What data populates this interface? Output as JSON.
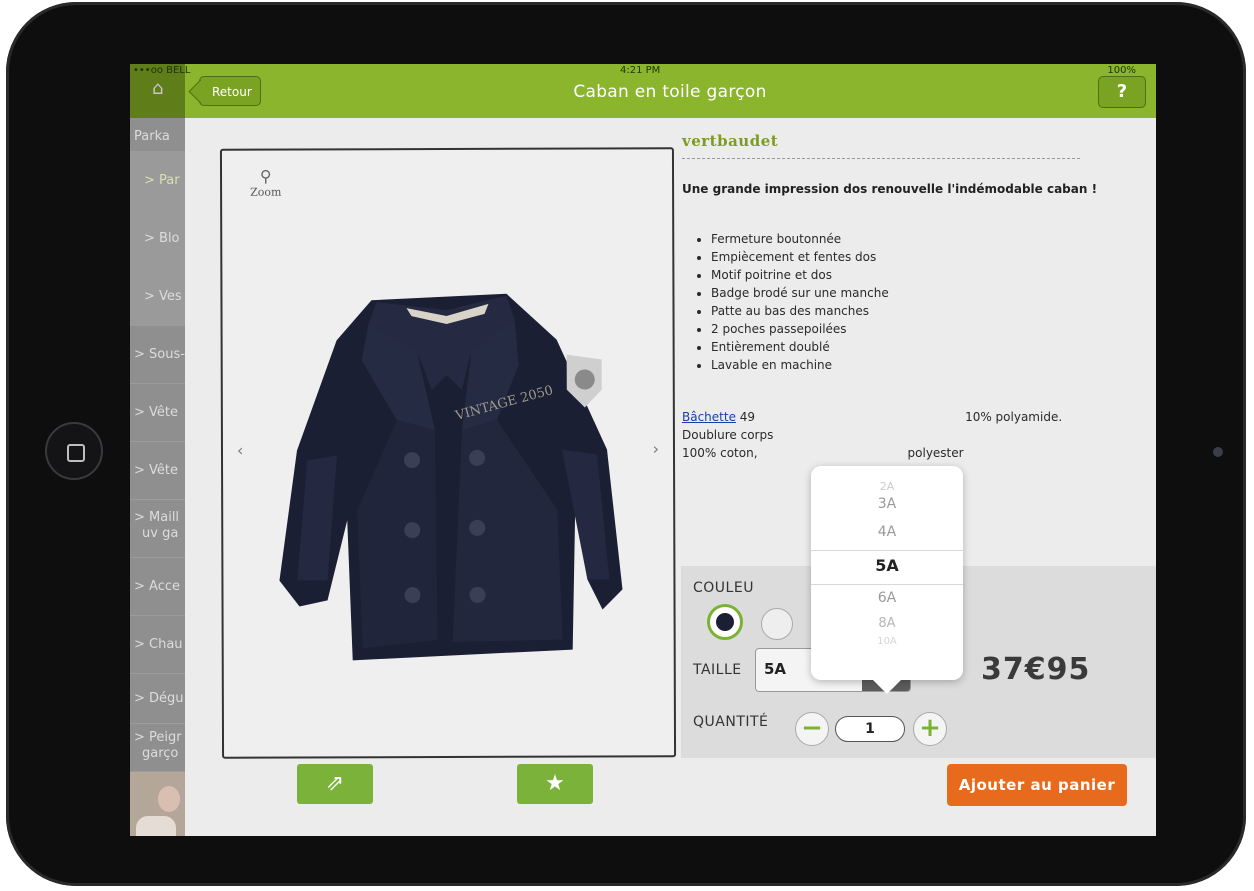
{
  "status": {
    "carrier": "•••oo BELL",
    "time": "4:21 PM",
    "battery": "100%"
  },
  "header": {
    "back_label": "Retour",
    "title": "Caban en toile garçon",
    "help_label": "?"
  },
  "sidebar": {
    "items": [
      {
        "label": "Parka"
      },
      {
        "label": "> Par"
      },
      {
        "label": "> Blo"
      },
      {
        "label": "> Ves"
      },
      {
        "label": "> Sous-"
      },
      {
        "label": "> Vête"
      },
      {
        "label": "> Vête"
      },
      {
        "label": "> Maill"
      },
      {
        "label": "uv ga"
      },
      {
        "label": "> Acce"
      },
      {
        "label": "> Chau"
      },
      {
        "label": "> Dégu"
      },
      {
        "label": "> Peigr"
      },
      {
        "label": "garço"
      }
    ]
  },
  "product": {
    "zoom_label": "Zoom",
    "brand": "vertbaudet",
    "tagline": "Une grande impression dos renouvelle l'indémodable caban !",
    "features": [
      "Fermeture boutonnée",
      "Empiècement et fentes dos",
      "Motif poitrine et dos",
      "Badge brodé sur une manche",
      "Patte au bas des manches",
      "2 poches passepoilées",
      "Entièrement doublé",
      "Lavable en machine"
    ],
    "material_link": "Bâchette",
    "material_text_1": " 49",
    "material_text_2": "10% polyamide. Doublure corps",
    "material_text_3": "100% coton,",
    "material_text_4": "polyester",
    "badge_text": "VINTAGE 2050"
  },
  "options": {
    "color_label": "COULEU",
    "size_label": "TAILLE",
    "size_value": "5A",
    "quantity_label": "QUANTITÉ",
    "quantity_value": "1",
    "price": "37€95",
    "add_to_cart": "Ajouter au panier"
  },
  "picker": {
    "options": [
      "2A",
      "3A",
      "4A",
      "5A",
      "6A",
      "8A",
      "10A"
    ],
    "selected": "5A"
  },
  "colors": {
    "accent": "#8ab52c",
    "cta": "#e86a1d",
    "garment": "#1b1f33"
  }
}
